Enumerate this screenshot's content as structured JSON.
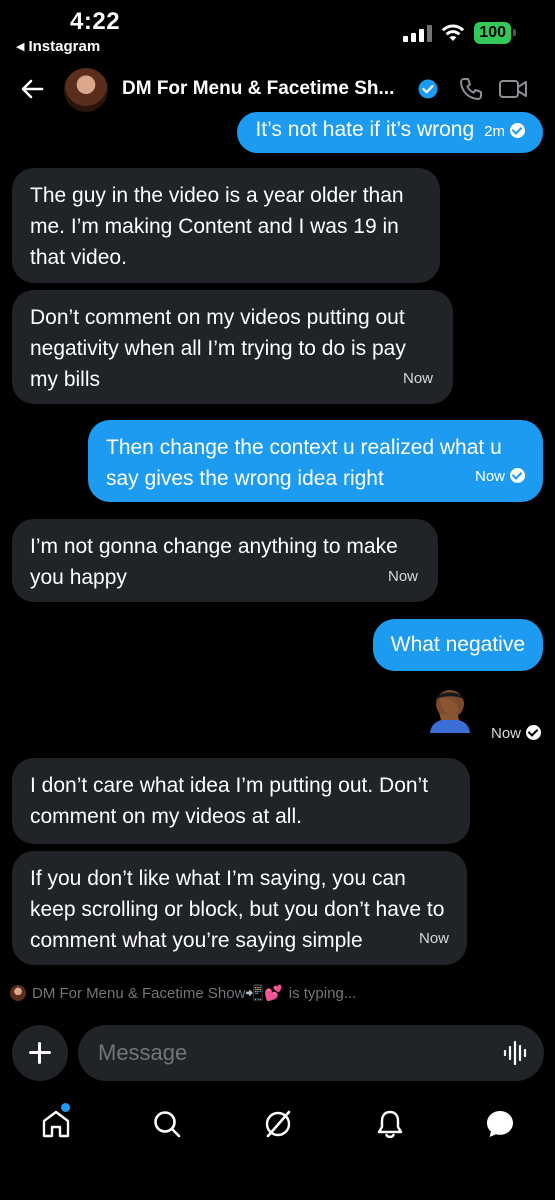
{
  "status_bar": {
    "time": "4:22",
    "back_app": "Instagram",
    "battery": "100"
  },
  "header": {
    "title": "DM For Menu & Facetime Sh..."
  },
  "messages": {
    "m0": {
      "text": "It’s not hate if it’s wrong",
      "time": "2m"
    },
    "m1": {
      "text": "The guy in the video is a year older than me. I’m making Content and I was 19 in that video."
    },
    "m2": {
      "text": "Don’t comment on my videos putting out negativity when all I’m trying to do is pay my bills",
      "time": "Now"
    },
    "m3": {
      "text": "Then change the context u realized what u say gives the wrong idea right",
      "time": "Now"
    },
    "m4": {
      "text": "I’m not gonna change anything to make you happy",
      "time": "Now"
    },
    "m5": {
      "text": "What negative"
    },
    "m6": {
      "emoji": "facepalm",
      "time": "Now"
    },
    "m7": {
      "text": "I don’t care what idea I’m putting out. Don’t comment on my videos at all."
    },
    "m8": {
      "text": "If you don’t like what I’m saying, you can keep scrolling or block, but you don’t have to comment what you’re saying simple",
      "time": "Now"
    }
  },
  "typing": {
    "name": "DM For Menu & Facetime Show📲💕",
    "suffix": "is typing..."
  },
  "composer": {
    "placeholder": "Message"
  },
  "nav": [
    "home-icon",
    "search-icon",
    "grok-icon",
    "notifications-icon",
    "messages-icon"
  ],
  "colors": {
    "accent": "#1d9bf0",
    "incoming_bubble": "#202327",
    "background": "#000000",
    "battery": "#34c759"
  }
}
